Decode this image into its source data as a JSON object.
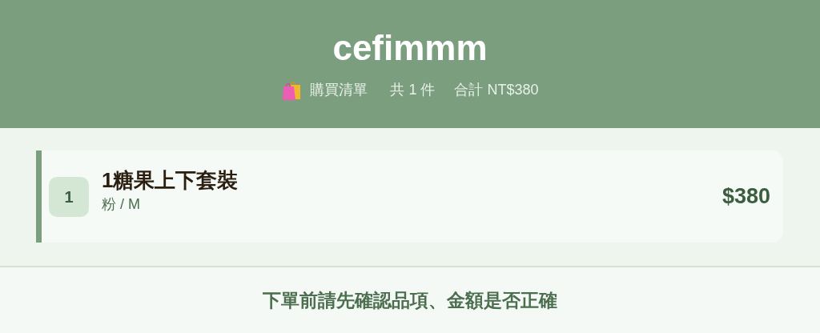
{
  "header": {
    "title": "cefimmm",
    "subtitle": {
      "label": "購買清單",
      "count": "共 1 件",
      "total": "合計 NT$380"
    }
  },
  "items": [
    {
      "index": "1",
      "name": "1糖果上下套裝",
      "variant": "粉 / M",
      "price": "$380"
    }
  ],
  "footer": {
    "note": "下單前請先確認品項、金額是否正確"
  }
}
